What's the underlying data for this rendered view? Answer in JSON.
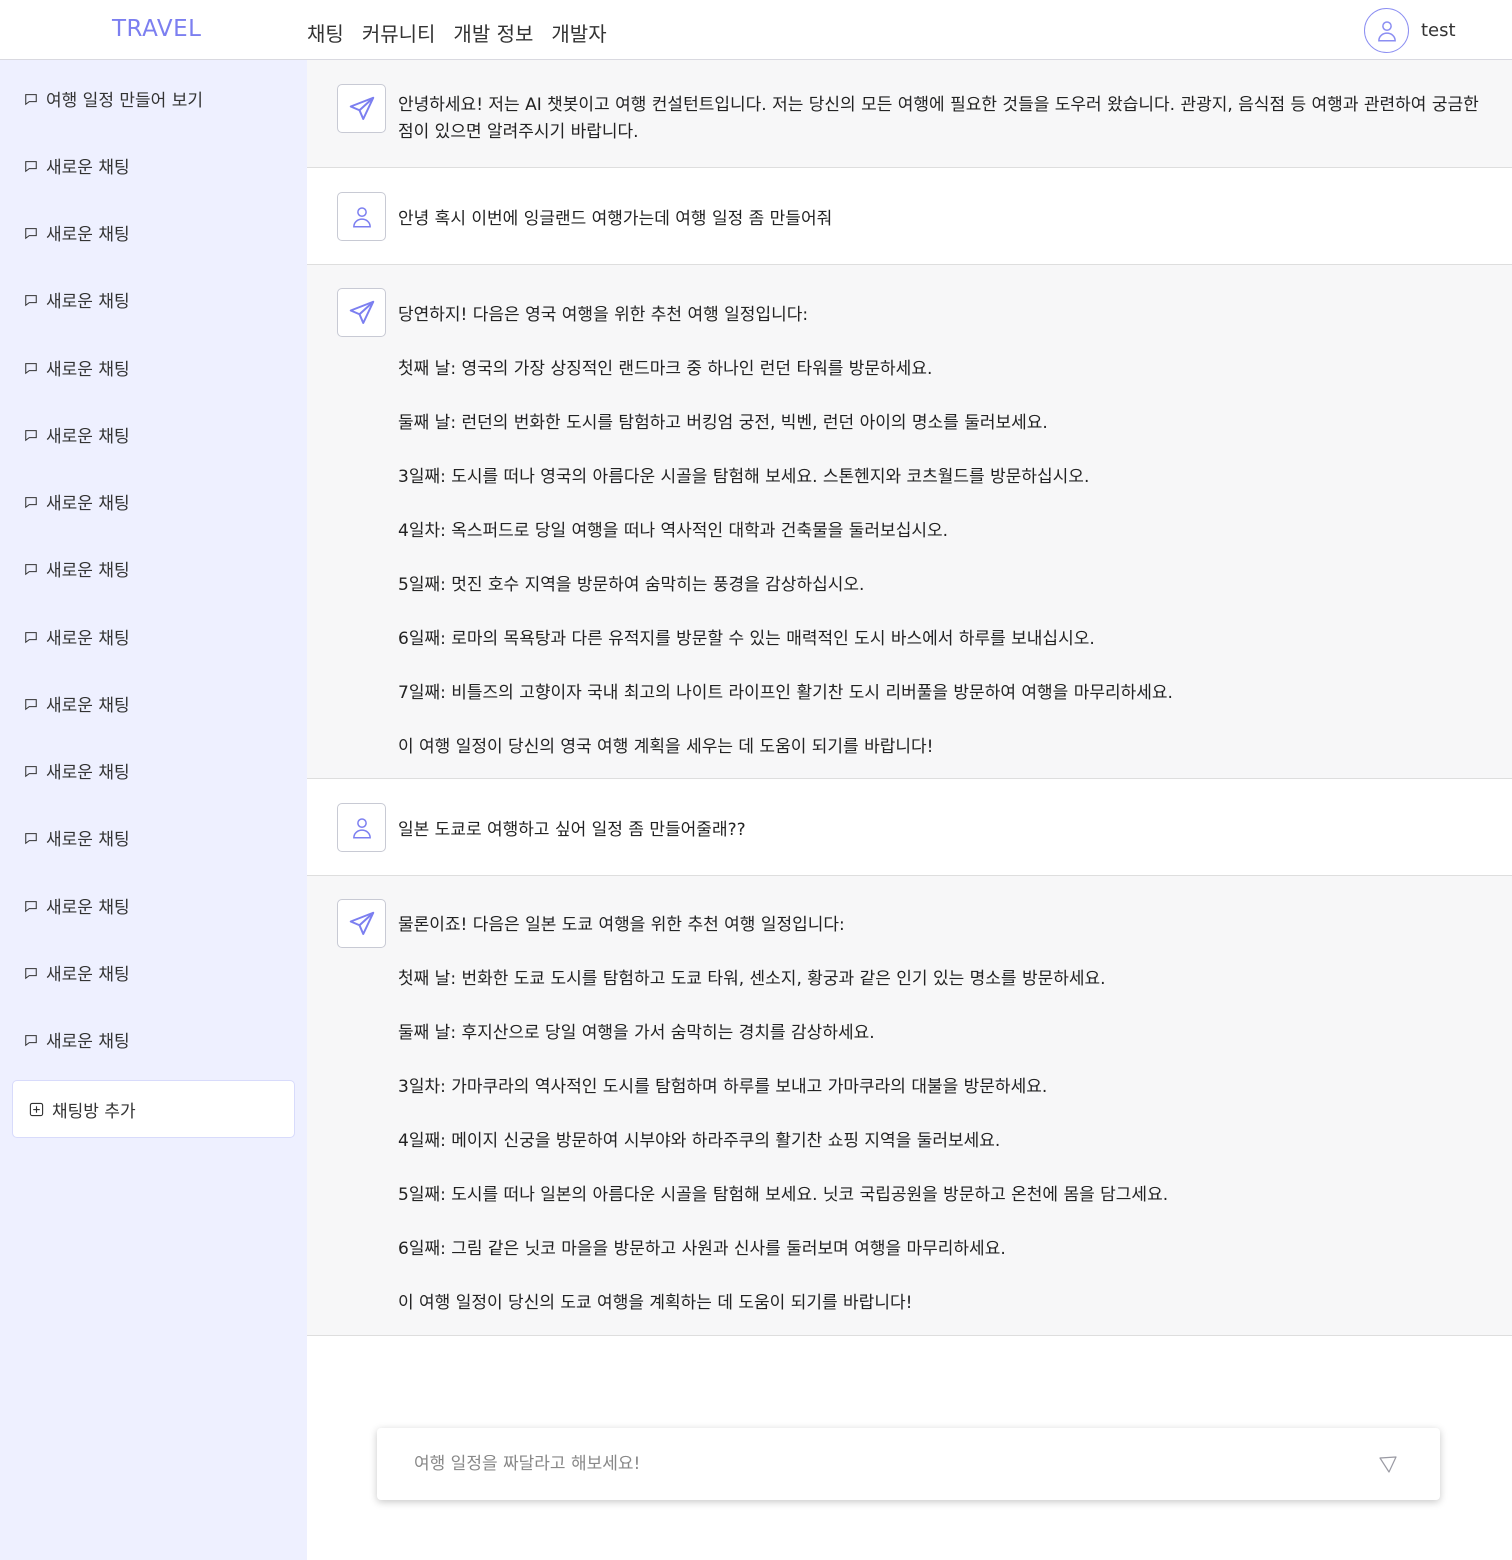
{
  "header": {
    "brand": "TRAVEL",
    "nav": [
      "채팅",
      "커뮤니티",
      "개발 정보",
      "개발자"
    ],
    "username": "test",
    "avatar_icon": "user-icon"
  },
  "sidebar": {
    "items": [
      "여행 일정 만들어 보기",
      "새로운 채팅",
      "새로운 채팅",
      "새로운 채팅",
      "새로운 채팅",
      "새로운 채팅",
      "새로운 채팅",
      "새로운 채팅",
      "새로운 채팅",
      "새로운 채팅",
      "새로운 채팅",
      "새로운 채팅",
      "새로운 채팅",
      "새로운 채팅",
      "새로운 채팅"
    ],
    "add_label": "채팅방 추가",
    "item_icon": "chat-bubble-icon",
    "add_icon": "plus-square-icon"
  },
  "messages": [
    {
      "role": "bot",
      "lines": [
        "안녕하세요! 저는 AI 챗봇이고 여행 컨설턴트입니다. 저는 당신의 모든 여행에 필요한 것들을 도우러 왔습니다. 관광지, 음식점 등 여행과 관련하여 궁금한 점이 있으면 알려주시기 바랍니다."
      ]
    },
    {
      "role": "user",
      "lines": [
        "안녕 혹시 이번에 잉글랜드 여행가는데 여행 일정 좀 만들어줘"
      ]
    },
    {
      "role": "bot",
      "lines": [
        "당연하지! 다음은 영국 여행을 위한 추천 여행 일정입니다:",
        "첫째 날: 영국의 가장 상징적인 랜드마크 중 하나인 런던 타워를 방문하세요.",
        "둘째 날: 런던의 번화한 도시를 탐험하고 버킹엄 궁전, 빅벤, 런던 아이의 명소를 둘러보세요.",
        "3일째: 도시를 떠나 영국의 아름다운 시골을 탐험해 보세요. 스톤헨지와 코츠월드를 방문하십시오.",
        "4일차: 옥스퍼드로 당일 여행을 떠나 역사적인 대학과 건축물을 둘러보십시오.",
        "5일째: 멋진 호수 지역을 방문하여 숨막히는 풍경을 감상하십시오.",
        "6일째: 로마의 목욕탕과 다른 유적지를 방문할 수 있는 매력적인 도시 바스에서 하루를 보내십시오.",
        "7일째: 비틀즈의 고향이자 국내 최고의 나이트 라이프인 활기찬 도시 리버풀을 방문하여 여행을 마무리하세요.",
        "이 여행 일정이 당신의 영국 여행 계획을 세우는 데 도움이 되기를 바랍니다!"
      ]
    },
    {
      "role": "user",
      "lines": [
        "일본 도쿄로 여행하고 싶어 일정 좀 만들어줄래??"
      ]
    },
    {
      "role": "bot",
      "lines": [
        "물론이죠! 다음은 일본 도쿄 여행을 위한 추천 여행 일정입니다:",
        "첫째 날: 번화한 도쿄 도시를 탐험하고 도쿄 타워, 센소지, 황궁과 같은 인기 있는 명소를 방문하세요.",
        "둘째 날: 후지산으로 당일 여행을 가서 숨막히는 경치를 감상하세요.",
        "3일차: 가마쿠라의 역사적인 도시를 탐험하며 하루를 보내고 가마쿠라의 대불을 방문하세요.",
        "4일째: 메이지 신궁을 방문하여 시부야와 하라주쿠의 활기찬 쇼핑 지역을 둘러보세요.",
        "5일째: 도시를 떠나 일본의 아름다운 시골을 탐험해 보세요. 닛코 국립공원을 방문하고 온천에 몸을 담그세요.",
        "6일째: 그림 같은 닛코 마을을 방문하고 사원과 신사를 둘러보며 여행을 마무리하세요.",
        "이 여행 일정이 당신의 도쿄 여행을 계획하는 데 도움이 되기를 바랍니다!"
      ]
    }
  ],
  "icons": {
    "bot": "paper-plane-icon",
    "user": "user-icon",
    "send": "send-icon"
  },
  "input": {
    "placeholder": "여행 일정을 짜달라고 해보세요!",
    "value": ""
  },
  "colors": {
    "accent": "#7c7ff0",
    "sidebar_bg": "#eef0ff",
    "bot_bg": "#f7f7f8"
  }
}
